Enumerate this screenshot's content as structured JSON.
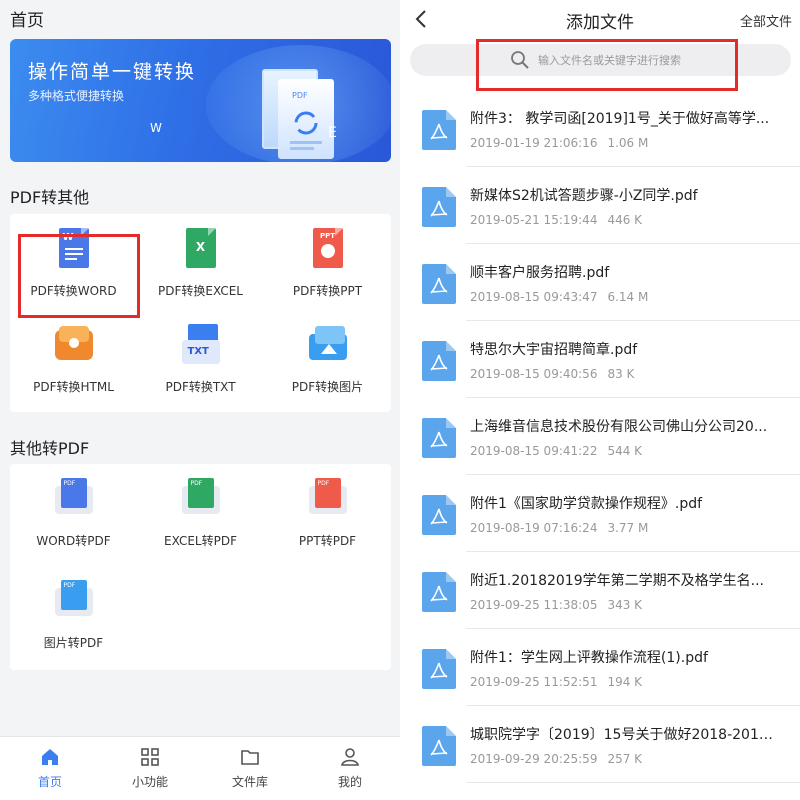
{
  "left": {
    "title": "首页",
    "banner": {
      "title": "操作简单一键转换",
      "subtitle": "多种格式便捷转换",
      "letter_w": "W",
      "letter_e": "E",
      "doc_label": "PDF"
    },
    "section1": {
      "title": "PDF转其他",
      "items": [
        {
          "label": "PDF转换WORD",
          "icon": "word-doc-icon",
          "color": "#4a78e8",
          "tag": "W"
        },
        {
          "label": "PDF转换EXCEL",
          "icon": "excel-doc-icon",
          "color": "#2fa864",
          "tag": "X"
        },
        {
          "label": "PDF转换PPT",
          "icon": "ppt-doc-icon",
          "color": "#ef5a4a",
          "tag": "PPT"
        },
        {
          "label": "PDF转换HTML",
          "icon": "html-doc-icon",
          "color": "#f0892e",
          "tag": ""
        },
        {
          "label": "PDF转换TXT",
          "icon": "txt-doc-icon",
          "color": "#3a7ef0",
          "tag": "TXT"
        },
        {
          "label": "PDF转换图片",
          "icon": "image-doc-icon",
          "color": "#3a9ef0",
          "tag": ""
        }
      ]
    },
    "section2": {
      "title": "其他转PDF",
      "items": [
        {
          "label": "WORD转PDF",
          "icon": "word-to-pdf-icon",
          "color": "#4a78e8",
          "tag": "PDF"
        },
        {
          "label": "EXCEL转PDF",
          "icon": "excel-to-pdf-icon",
          "color": "#2fa864",
          "tag": "PDF"
        },
        {
          "label": "PPT转PDF",
          "icon": "ppt-to-pdf-icon",
          "color": "#ef5a4a",
          "tag": "PDF"
        },
        {
          "label": "图片转PDF",
          "icon": "image-to-pdf-icon",
          "color": "#3a9ef0",
          "tag": "PDF"
        }
      ]
    },
    "nav": [
      {
        "label": "首页",
        "icon": "home-icon",
        "active": true
      },
      {
        "label": "小功能",
        "icon": "grid-icon",
        "active": false
      },
      {
        "label": "文件库",
        "icon": "folder-icon",
        "active": false
      },
      {
        "label": "我的",
        "icon": "user-icon",
        "active": false
      }
    ]
  },
  "right": {
    "title": "添加文件",
    "all_files": "全部文件",
    "search_placeholder": "输入文件名或关键字进行搜索",
    "files": [
      {
        "name": "附件3： 教学司函[2019]1号_关于做好高等学...",
        "date": "2019-01-19 21:06:16",
        "size": "1.06 M"
      },
      {
        "name": "新媒体S2机试答题步骤-小Z同学.pdf",
        "date": "2019-05-21 15:19:44",
        "size": "446 K"
      },
      {
        "name": "顺丰客户服务招聘.pdf",
        "date": "2019-08-15 09:43:47",
        "size": "6.14 M"
      },
      {
        "name": "特思尔大宇宙招聘简章.pdf",
        "date": "2019-08-15 09:40:56",
        "size": "83 K"
      },
      {
        "name": "上海维音信息技术股份有限公司佛山分公司20...",
        "date": "2019-08-15 09:41:22",
        "size": "544 K"
      },
      {
        "name": "附件1《国家助学贷款操作规程》.pdf",
        "date": "2019-08-19 07:16:24",
        "size": "3.77 M"
      },
      {
        "name": "附近1.20182019学年第二学期不及格学生名...",
        "date": "2019-09-25 11:38:05",
        "size": "343 K"
      },
      {
        "name": "附件1：学生网上评教操作流程(1).pdf",
        "date": "2019-09-25 11:52:51",
        "size": "194 K"
      },
      {
        "name": "城职院学字〔2019〕15号关于做好2018-2019...",
        "date": "2019-09-29 20:25:59",
        "size": "257 K"
      }
    ],
    "file_icon_color": "#5aa5ec"
  }
}
